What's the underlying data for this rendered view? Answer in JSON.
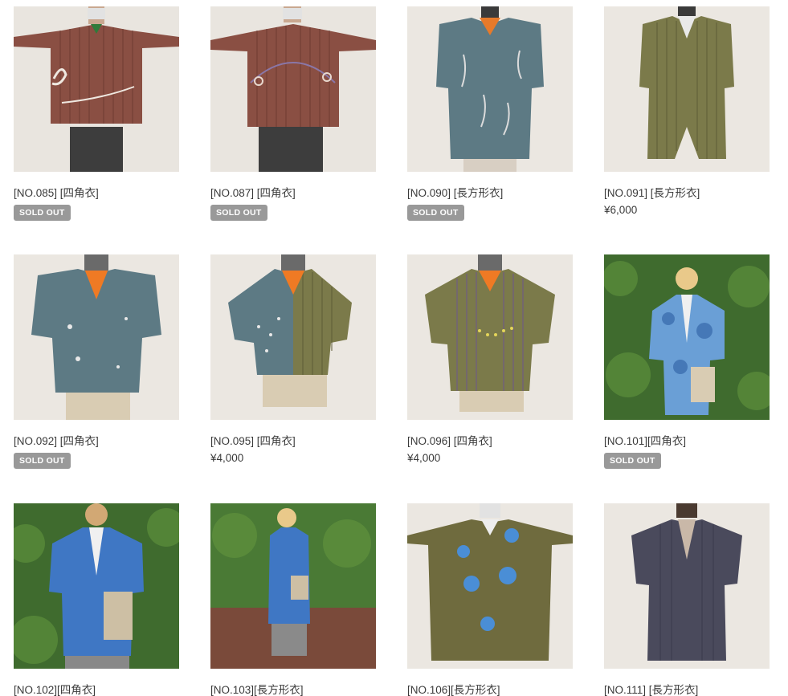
{
  "colors": {
    "badge_bg": "#999999",
    "text": "#3a3a3a"
  },
  "products": [
    {
      "title": "[NO.085] [四角衣]",
      "status": "SOLD OUT",
      "price": ""
    },
    {
      "title": "[NO.087] [四角衣]",
      "status": "SOLD OUT",
      "price": ""
    },
    {
      "title": "[NO.090] [長方形衣]",
      "status": "SOLD OUT",
      "price": ""
    },
    {
      "title": "[NO.091] [長方形衣]",
      "status": "",
      "price": "¥6,000"
    },
    {
      "title": "[NO.092] [四角衣]",
      "status": "SOLD OUT",
      "price": ""
    },
    {
      "title": "[NO.095] [四角衣]",
      "status": "",
      "price": "¥4,000"
    },
    {
      "title": "[NO.096] [四角衣]",
      "status": "",
      "price": "¥4,000"
    },
    {
      "title": "[NO.101][四角衣]",
      "status": "SOLD OUT",
      "price": ""
    },
    {
      "title": "[NO.102][四角衣]",
      "status": "",
      "price": ""
    },
    {
      "title": "[NO.103][長方形衣]",
      "status": "",
      "price": ""
    },
    {
      "title": "[NO.106][長方形衣]",
      "status": "",
      "price": ""
    },
    {
      "title": "[NO.111] [長方形衣]",
      "status": "",
      "price": ""
    }
  ]
}
